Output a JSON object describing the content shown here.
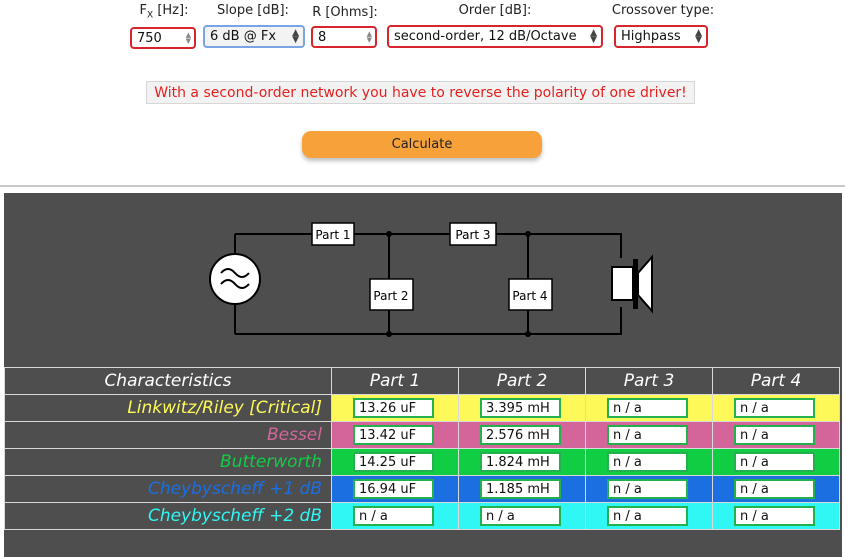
{
  "controls": {
    "fx": {
      "label_main": "F",
      "label_sub": "X",
      "label_rest": " [Hz]:",
      "value": "750"
    },
    "slope": {
      "label": "Slope [dB]:",
      "value": "6 dB @ Fx"
    },
    "resistance": {
      "label": "R [Ohms]:",
      "value": "8"
    },
    "order": {
      "label": "Order [dB]:",
      "value": "second-order, 12 dB/Octave"
    },
    "crossover_type": {
      "label": "Crossover type:",
      "value": "Highpass"
    }
  },
  "warning": "With a second-order network you have to reverse the polarity of one driver!",
  "calculate_label": "Calculate",
  "diagram": {
    "parts": [
      "Part 1",
      "Part 2",
      "Part 3",
      "Part 4"
    ]
  },
  "table": {
    "headers": [
      "Characteristics",
      "Part 1",
      "Part 2",
      "Part 3",
      "Part 4"
    ],
    "rows": [
      {
        "name": "Linkwitz/Riley [Critical]",
        "values": [
          "13.26 uF",
          "3.395 mH",
          "n / a",
          "n / a"
        ]
      },
      {
        "name": "Bessel",
        "values": [
          "13.42 uF",
          "2.576 mH",
          "n / a",
          "n / a"
        ]
      },
      {
        "name": "Butterworth",
        "values": [
          "14.25 uF",
          "1.824 mH",
          "n / a",
          "n / a"
        ]
      },
      {
        "name": "Cheybyscheff +1 dB",
        "values": [
          "16.94 uF",
          "1.185 mH",
          "n / a",
          "n / a"
        ]
      },
      {
        "name": "Cheybyscheff +2 dB",
        "values": [
          "n / a",
          "n / a",
          "n / a",
          "n / a"
        ]
      }
    ]
  },
  "colors": {
    "linkwitz_text": "#fdf958",
    "bessel_text": "#d4659b",
    "butterworth_text": "#10cd44",
    "cheb1_text": "#1c6fe0",
    "cheb2_text": "#30f6f4"
  }
}
